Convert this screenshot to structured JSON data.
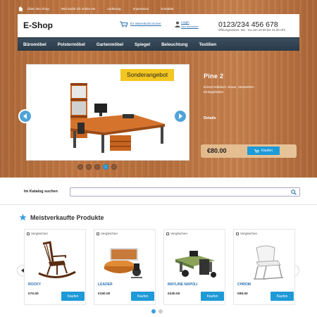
{
  "topnav": {
    "items": [
      "Über den Shop",
      "Wie kaufe ich online ein",
      "Lieferung",
      "Impressum",
      "Kontakte"
    ]
  },
  "header": {
    "logo": "E-Shop",
    "cart_text": "Ihr Warenkorb ist leer",
    "login": "Login",
    "register": "Neu anmelden",
    "phone": "0123/234 456 678",
    "hours": "Öffnungszeiten: Mo - So von 10.00 bis 21.00 Uhr"
  },
  "menu": {
    "items": [
      "Büromöbel",
      "Polstermöbel",
      "Gartenmöbel",
      "Spiegel",
      "Beleuchtung",
      "Textilien"
    ]
  },
  "slider": {
    "badge": "Sonderangebot",
    "title": "Pine 2",
    "description": "Eckschreibtisch, braun, Versetztem Einlegeböden",
    "details": "Details",
    "price": "€80.00",
    "buy_label": "Kaufen",
    "dots_active": 3
  },
  "search": {
    "label": "Im Katalog suchen",
    "placeholder": ""
  },
  "bestsellers": {
    "title": "Meistverkaufte Produkte",
    "compare_label": "Vergleichen",
    "buy_label": "Kaufen",
    "products": [
      {
        "name": "ROCKY",
        "price": "€70.00"
      },
      {
        "name": "LEADER",
        "price": "€150.00"
      },
      {
        "name": "MAYLINE NAPOLI",
        "price": "€330.00"
      },
      {
        "name": "CHROM",
        "price": "€99.00"
      }
    ]
  },
  "colors": {
    "accent": "#1e9ad7",
    "menu_bg": "#2f4050",
    "badge": "#f3c620",
    "link": "#2a6fb0"
  }
}
